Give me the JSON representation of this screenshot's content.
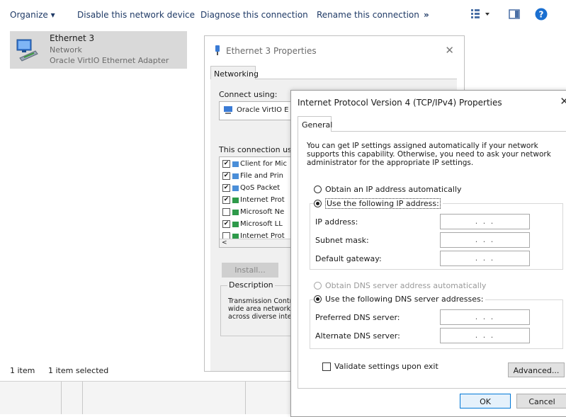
{
  "toolbar": {
    "organize": "Organize ▾",
    "disable": "Disable this network device",
    "diagnose": "Diagnose this connection",
    "rename": "Rename this connection",
    "more": "»"
  },
  "adapter": {
    "name": "Ethernet 3",
    "status": "Network",
    "device": "Oracle VirtIO Ethernet Adapter"
  },
  "statusbar": {
    "count": "1 item",
    "selected": "1 item selected"
  },
  "properties": {
    "title": "Ethernet 3 Properties",
    "tab": "Networking",
    "connect_using": "Connect using:",
    "adapter_trunc": "Oracle VirtIO E",
    "items_label": "This connection uses",
    "items": [
      {
        "checked": true,
        "label": "Client for Mic"
      },
      {
        "checked": true,
        "label": "File and Prin"
      },
      {
        "checked": true,
        "label": "QoS Packet"
      },
      {
        "checked": true,
        "label": "Internet Prot"
      },
      {
        "checked": false,
        "label": "Microsoft Ne"
      },
      {
        "checked": true,
        "label": "Microsoft LL"
      },
      {
        "checked": false,
        "label": "Internet Prot"
      }
    ],
    "install": "Install...",
    "description_label": "Description",
    "description_lines": [
      "Transmission Contr",
      "wide area network",
      "across diverse inte"
    ]
  },
  "ipv4": {
    "title": "Internet Protocol Version 4 (TCP/IPv4) Properties",
    "tab": "General",
    "intro": "You can get IP settings assigned automatically if your network supports this capability. Otherwise, you need to ask your network administrator for the appropriate IP settings.",
    "obtain_ip": "Obtain an IP address automatically",
    "use_ip": "Use the following IP address:",
    "ip_label": "IP address:",
    "mask_label": "Subnet mask:",
    "gateway_label": "Default gateway:",
    "obtain_dns": "Obtain DNS server address automatically",
    "use_dns": "Use the following DNS server addresses:",
    "pref_dns_label": "Preferred DNS server:",
    "alt_dns_label": "Alternate DNS server:",
    "ip_placeholder": ".   .   .",
    "validate": "Validate settings upon exit",
    "advanced": "Advanced...",
    "ok": "OK",
    "cancel": "Cancel",
    "close": "✕"
  },
  "icons": {
    "nic": "network-adapter-icon",
    "view": "view-options-icon",
    "pane": "preview-pane-icon",
    "help": "help-icon"
  }
}
